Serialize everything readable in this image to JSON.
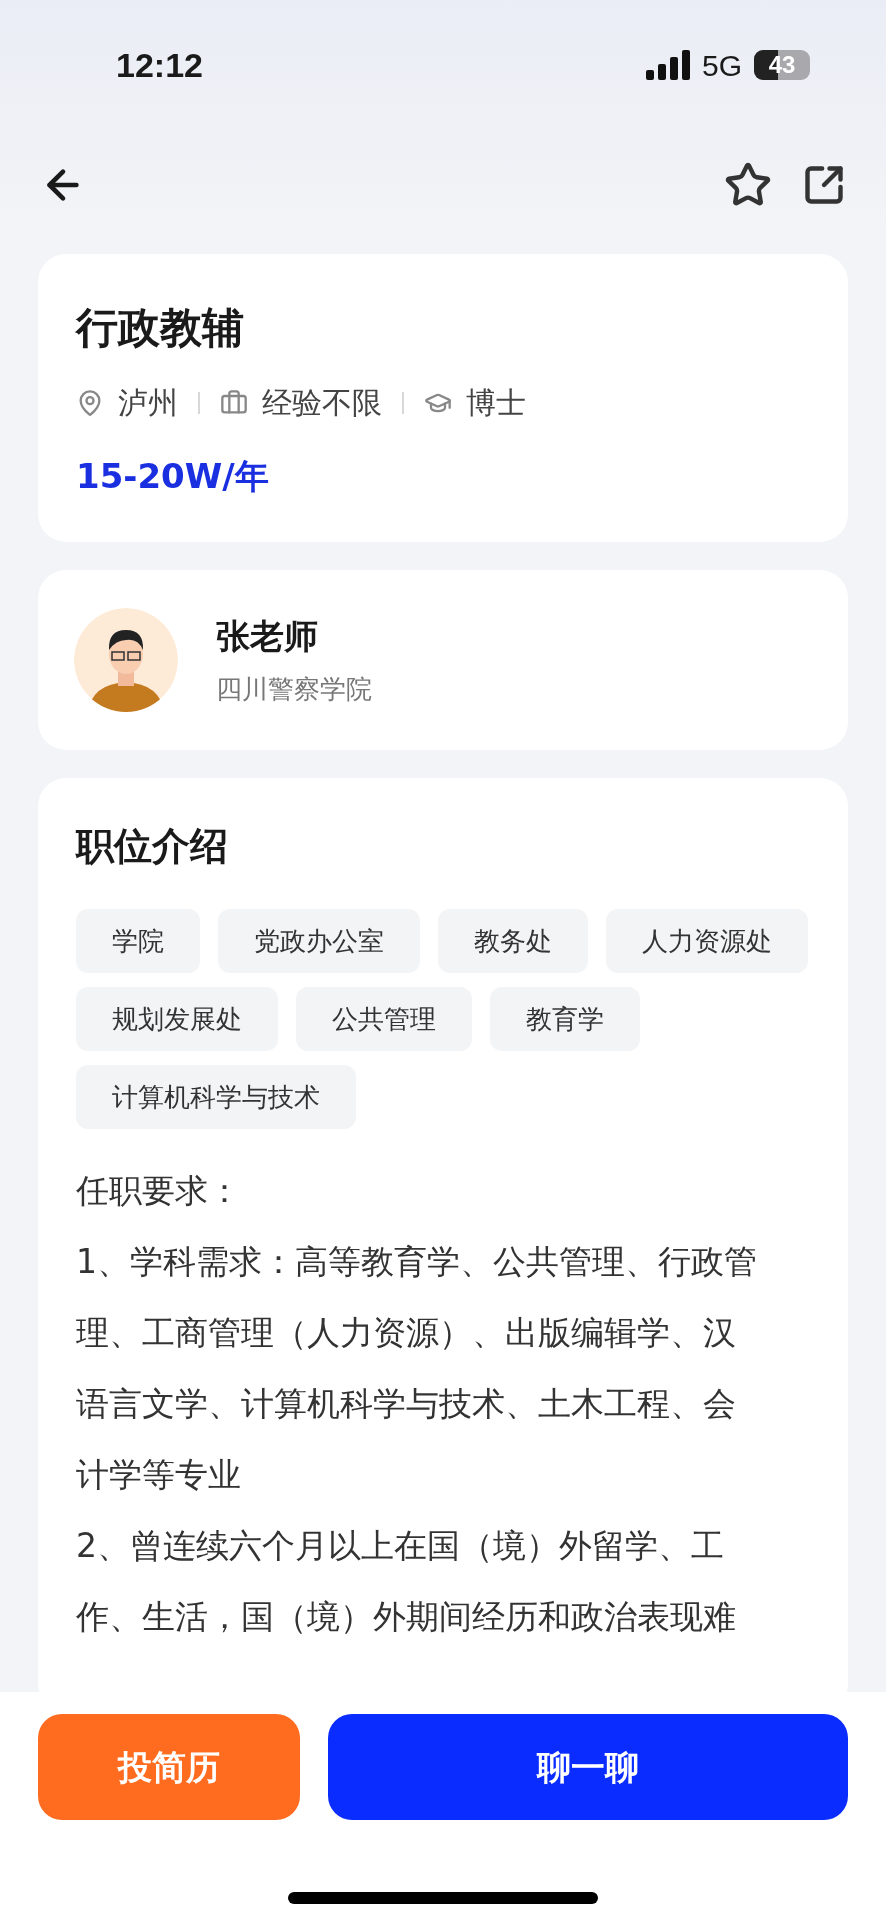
{
  "status_bar": {
    "time": "12:12",
    "network": "5G",
    "battery": "43"
  },
  "job": {
    "title": "行政教辅",
    "meta": [
      {
        "kind": "location",
        "text": "泸州"
      },
      {
        "kind": "experience",
        "text": "经验不限"
      },
      {
        "kind": "education",
        "text": "博士"
      }
    ],
    "salary": "15-20W/年"
  },
  "recruiter": {
    "name": "张老师",
    "org": "四川警察学院"
  },
  "description": {
    "heading": "职位介绍",
    "tags": [
      "学院",
      "党政办公室",
      "教务处",
      "人力资源处",
      "规划发展处",
      "公共管理",
      "教育学",
      "计算机科学与技术"
    ],
    "paragraphs": [
      "任职要求：",
      "1、学科需求：高等教育学、公共管理、行政管理、工商管理（人力资源）、出版编辑学、汉语言文学、计算机科学与技术、土木工程、会计学等专业",
      "2、曾连续六个月以上在国（境）外留学、工作、生活，国（境）外期间经历和政治表现难"
    ]
  },
  "actions": [
    {
      "kind": "secondary",
      "label": "投简历"
    },
    {
      "kind": "primary",
      "label": "聊一聊"
    }
  ]
}
